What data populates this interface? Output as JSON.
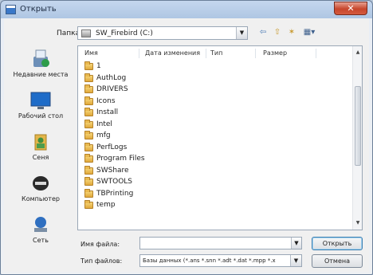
{
  "window": {
    "title": "Открыть",
    "close_glyph": "✕"
  },
  "lookin": {
    "label": "Папка:",
    "value": "SW_Firebird (C:)",
    "arrow": "▼"
  },
  "toolbar": {
    "back": "⇦",
    "up": "⇧",
    "new_folder": "✶",
    "views": "▦▾"
  },
  "places": [
    {
      "label": "Недавние места",
      "icon": "recent-places-icon"
    },
    {
      "label": "Рабочий стол",
      "icon": "desktop-icon"
    },
    {
      "label": "Сеня",
      "icon": "user-folder-icon"
    },
    {
      "label": "Компьютер",
      "icon": "computer-icon"
    },
    {
      "label": "Сеть",
      "icon": "network-icon"
    }
  ],
  "columns": {
    "name": "Имя",
    "modified": "Дата изменения",
    "type": "Тип",
    "size": "Размер"
  },
  "files": [
    "1",
    "AuthLog",
    "DRIVERS",
    "Icons",
    "Install",
    "Intel",
    "mfg",
    "PerfLogs",
    "Program Files",
    "SWShare",
    "SWTOOLS",
    "TBPrinting",
    "temp"
  ],
  "bottom": {
    "filename_label": "Имя файла:",
    "filename_value": "",
    "filetype_label": "Тип файлов:",
    "filetype_value": "Базы данных (*.ans *.snn *.adt *.dat *.mpp *.x",
    "open_button": "Открыть",
    "cancel_button": "Отмена",
    "arrow": "▼"
  },
  "colors": {
    "title_bg": "#aec6e3",
    "close_bg": "#c7462c",
    "folder": "#e0a83a"
  }
}
